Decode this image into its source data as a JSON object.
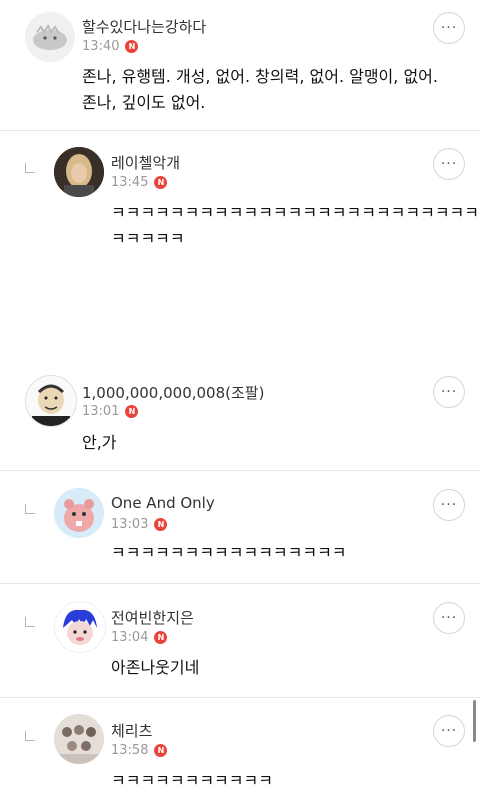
{
  "comments": [
    {
      "nick": "할수있다나는강하다",
      "time": "13:40",
      "badge": "N",
      "body": [
        "존나, 유행템. 개성, 없어. 창의력, 없어. 알맹이, 없어.",
        "존나, 깊이도 없어."
      ]
    },
    {
      "nick": "레이첼악개",
      "time": "13:45",
      "badge": "N",
      "body": [
        "ㅋㅋㅋㅋㅋㅋㅋㅋㅋㅋㅋㅋㅋㅋㅋㅋㅋㅋㅋㅋㅋㅋㅋㅋㅋ",
        "ㅋㅋㅋㅋㅋ"
      ]
    },
    {
      "nick": "1,000,000,000,008(조팔)",
      "time": "13:01",
      "badge": "N",
      "body": [
        "안,가"
      ]
    },
    {
      "nick": "One And Only",
      "time": "13:03",
      "badge": "N",
      "body": [
        "ㅋㅋㅋㅋㅋㅋㅋㅋㅋㅋㅋㅋㅋㅋㅋㅋ"
      ]
    },
    {
      "nick": "전여빈한지은",
      "time": "13:04",
      "badge": "N",
      "body": [
        "아존나웃기네"
      ]
    },
    {
      "nick": "체리츠",
      "time": "13:58",
      "badge": "N",
      "body": [
        "ㅋㅋㅋㅋㅋㅋㅋㅋㅋㅋㅋ"
      ]
    }
  ],
  "more_label": "···",
  "icons": {
    "avatar0": "dinosaur-plush-avatar",
    "avatar1": "blonde-woman-avatar",
    "avatar2": "meme-face-avatar",
    "avatar3": "pink-beaver-avatar",
    "avatar4": "blue-hair-character-avatar",
    "avatar5": "group-photo-avatar"
  }
}
